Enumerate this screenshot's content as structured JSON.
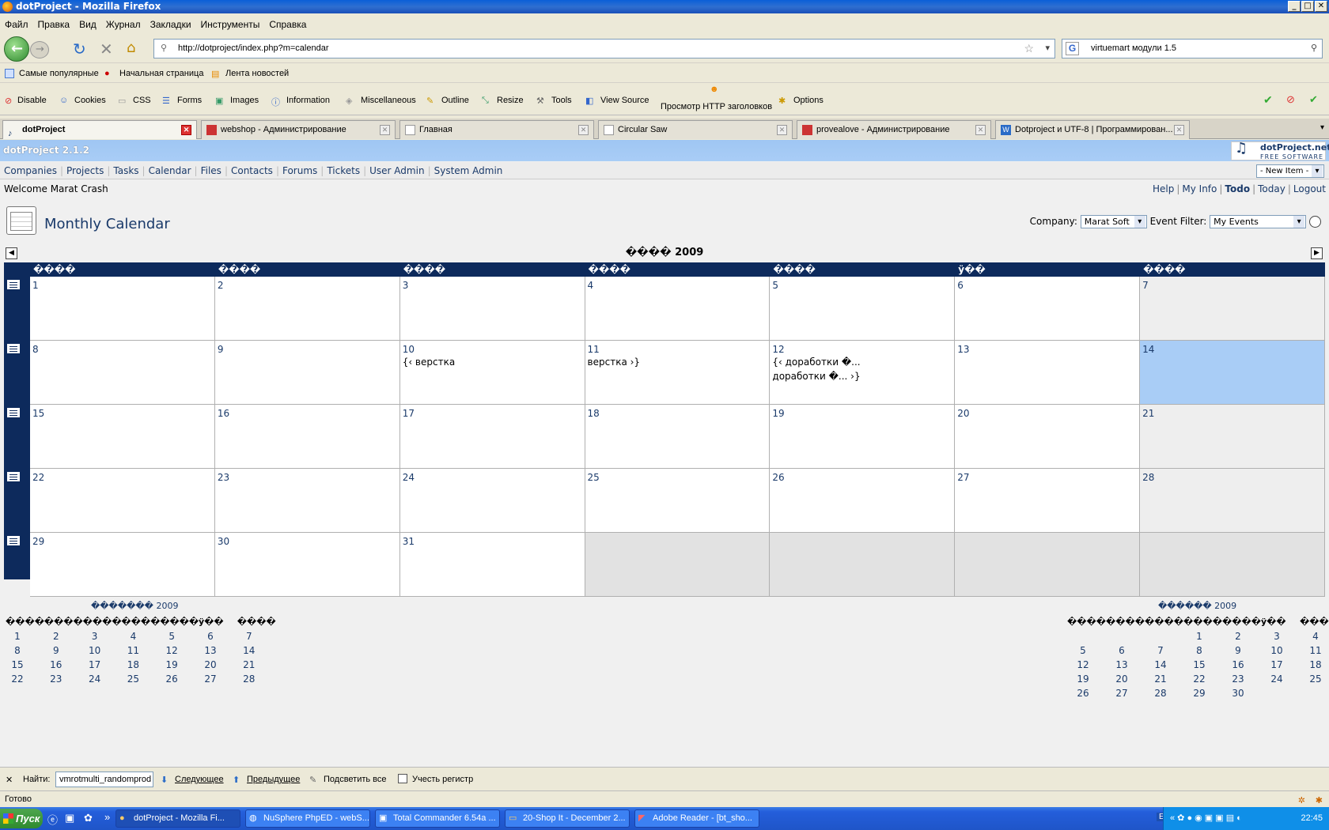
{
  "window": {
    "title": "dotProject - Mozilla Firefox"
  },
  "menu": [
    "Файл",
    "Правка",
    "Вид",
    "Журнал",
    "Закладки",
    "Инструменты",
    "Справка"
  ],
  "url": "http://dotproject/index.php?m=calendar",
  "search_query": "virtuemart модули 1.5",
  "bookmarks": [
    "Самые популярные",
    "Начальная страница",
    "Лента новостей"
  ],
  "devbar": [
    "Disable",
    "Cookies",
    "CSS",
    "Forms",
    "Images",
    "Information",
    "Miscellaneous",
    "Outline",
    "Resize",
    "Tools",
    "View Source",
    "Просмотр HTTP заголовков",
    "Options"
  ],
  "tabs": [
    {
      "label": "dotProject",
      "active": true
    },
    {
      "label": "webshop - Администрирование"
    },
    {
      "label": "Главная"
    },
    {
      "label": "Circular Saw"
    },
    {
      "label": "provealove - Администрирование"
    },
    {
      "label": "Dotproject и UTF-8 | Программирован..."
    }
  ],
  "app": {
    "name": "dotProject 2.1.2",
    "logo_line1": "dotProject.net",
    "logo_line2": "FREE SOFTWARE",
    "nav": [
      "Companies",
      "Projects",
      "Tasks",
      "Calendar",
      "Files",
      "Contacts",
      "Forums",
      "Tickets",
      "User Admin",
      "System Admin"
    ],
    "new_item": "- New Item -",
    "welcome": "Welcome Marat Crash",
    "top_links": [
      "Help",
      "My Info",
      "Todo",
      "Today",
      "Logout"
    ]
  },
  "calendar": {
    "title": "Monthly Calendar",
    "company_label": "Company:",
    "company_value": "Marat Soft",
    "event_filter_label": "Event Filter:",
    "event_filter_value": "My Events",
    "month_heading": "���� 2009",
    "day_headers": [
      "����",
      "����",
      "����",
      "����",
      "����",
      "ÿ��",
      "����"
    ],
    "weeks": [
      [
        {
          "d": "1"
        },
        {
          "d": "2"
        },
        {
          "d": "3"
        },
        {
          "d": "4"
        },
        {
          "d": "5"
        },
        {
          "d": "6"
        },
        {
          "d": "7"
        }
      ],
      [
        {
          "d": "8"
        },
        {
          "d": "9"
        },
        {
          "d": "10",
          "ev": [
            "{‹ верстка"
          ]
        },
        {
          "d": "11",
          "ev": [
            "верстка ›}"
          ]
        },
        {
          "d": "12",
          "ev": [
            "{‹ доработки �...",
            "доработки �... ›}"
          ]
        },
        {
          "d": "13"
        },
        {
          "d": "14",
          "today": true
        }
      ],
      [
        {
          "d": "15"
        },
        {
          "d": "16"
        },
        {
          "d": "17"
        },
        {
          "d": "18"
        },
        {
          "d": "19"
        },
        {
          "d": "20"
        },
        {
          "d": "21"
        }
      ],
      [
        {
          "d": "22"
        },
        {
          "d": "23"
        },
        {
          "d": "24"
        },
        {
          "d": "25"
        },
        {
          "d": "26"
        },
        {
          "d": "27"
        },
        {
          "d": "28"
        }
      ],
      [
        {
          "d": "29"
        },
        {
          "d": "30"
        },
        {
          "d": "31"
        },
        {
          "d": ""
        },
        {
          "d": ""
        },
        {
          "d": ""
        },
        {
          "d": ""
        }
      ]
    ]
  },
  "mini_prev": {
    "title": "������� 2009",
    "heads": [
      "����",
      "����",
      "����",
      "����",
      "����",
      "ÿ��",
      "����"
    ],
    "rows": [
      [
        "1",
        "2",
        "3",
        "4",
        "5",
        "6",
        "7"
      ],
      [
        "8",
        "9",
        "10",
        "11",
        "12",
        "13",
        "14"
      ],
      [
        "15",
        "16",
        "17",
        "18",
        "19",
        "20",
        "21"
      ],
      [
        "22",
        "23",
        "24",
        "25",
        "26",
        "27",
        "28"
      ]
    ]
  },
  "mini_next": {
    "title": "������ 2009",
    "heads": [
      "����",
      "����",
      "����",
      "����",
      "����",
      "ÿ��",
      "����"
    ],
    "rows": [
      [
        "",
        "",
        "",
        "1",
        "2",
        "3",
        "4"
      ],
      [
        "5",
        "6",
        "7",
        "8",
        "9",
        "10",
        "11"
      ],
      [
        "12",
        "13",
        "14",
        "15",
        "16",
        "17",
        "18"
      ],
      [
        "19",
        "20",
        "21",
        "22",
        "23",
        "24",
        "25"
      ],
      [
        "26",
        "27",
        "28",
        "29",
        "30",
        "",
        ""
      ]
    ]
  },
  "findbar": {
    "label": "Найти:",
    "value": "vmrotmulti_randomprod",
    "next": "Следующее",
    "prev": "Предыдущее",
    "highlight": "Подсветить все",
    "case": "Учесть регистр"
  },
  "status": "Готово",
  "taskbar": {
    "start": "Пуск",
    "tasks": [
      "dotProject - Mozilla Fi...",
      "NuSphere PhpED - webS...",
      "Total Commander 6.54a ...",
      "20-Shop It - December 2...",
      "Adobe Reader - [bt_sho..."
    ],
    "lang": "EN",
    "clock": "22:45"
  }
}
